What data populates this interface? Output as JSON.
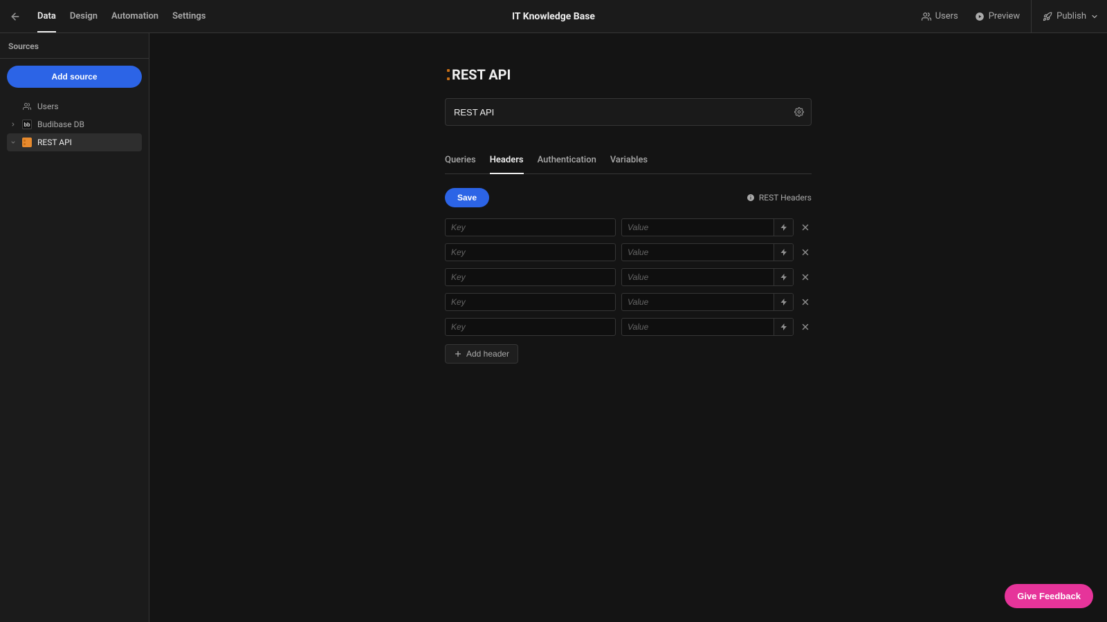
{
  "app_title": "IT Knowledge Base",
  "nav": {
    "tabs": [
      {
        "label": "Data",
        "active": true
      },
      {
        "label": "Design",
        "active": false
      },
      {
        "label": "Automation",
        "active": false
      },
      {
        "label": "Settings",
        "active": false
      }
    ],
    "users_label": "Users",
    "preview_label": "Preview",
    "publish_label": "Publish"
  },
  "sidebar": {
    "title": "Sources",
    "add_source_label": "Add source",
    "items": [
      {
        "icon": "users",
        "label": "Users",
        "expandable": false,
        "selected": false
      },
      {
        "icon": "db",
        "label": "Budibase DB",
        "expandable": true,
        "expanded": false,
        "selected": false
      },
      {
        "icon": "plug",
        "label": "REST API",
        "expandable": true,
        "expanded": true,
        "selected": true
      }
    ]
  },
  "page": {
    "title": "REST API",
    "name_value": "REST API",
    "inner_tabs": [
      {
        "label": "Queries",
        "active": false
      },
      {
        "label": "Headers",
        "active": true
      },
      {
        "label": "Authentication",
        "active": false
      },
      {
        "label": "Variables",
        "active": false
      }
    ],
    "save_label": "Save",
    "section_label": "REST Headers",
    "key_placeholder": "Key",
    "value_placeholder": "Value",
    "rows": [
      {
        "key": "",
        "value": ""
      },
      {
        "key": "",
        "value": ""
      },
      {
        "key": "",
        "value": ""
      },
      {
        "key": "",
        "value": ""
      },
      {
        "key": "",
        "value": ""
      }
    ],
    "add_header_label": "Add header"
  },
  "feedback_label": "Give Feedback"
}
